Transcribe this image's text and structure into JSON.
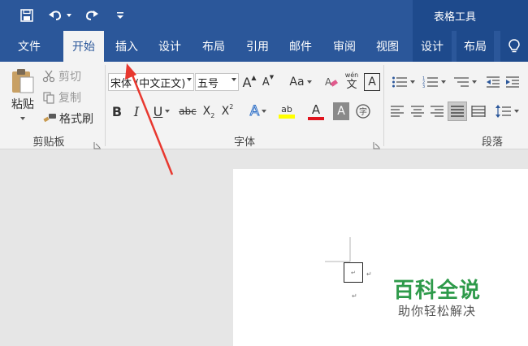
{
  "app": {
    "context_title": "表格工具"
  },
  "tabs": [
    {
      "label": "文件"
    },
    {
      "label": "开始"
    },
    {
      "label": "插入"
    },
    {
      "label": "设计"
    },
    {
      "label": "布局"
    },
    {
      "label": "引用"
    },
    {
      "label": "邮件"
    },
    {
      "label": "审阅"
    },
    {
      "label": "视图"
    },
    {
      "label": "设计"
    },
    {
      "label": "布局"
    }
  ],
  "clipboard": {
    "paste": "粘贴",
    "cut": "剪切",
    "copy": "复制",
    "format_painter": "格式刷",
    "group_label": "剪贴板"
  },
  "font": {
    "font_name": "宋体 (中文正文)",
    "font_size": "五号",
    "grow": "A",
    "shrink": "A",
    "change_case": "Aa",
    "phonetic_top": "wén",
    "phonetic_bottom": "文",
    "char_border": "A",
    "bold": "B",
    "italic": "I",
    "underline": "U",
    "strikethrough": "abc",
    "subscript": "X",
    "superscript": "X",
    "text_effects": "A",
    "highlight": "ab",
    "font_color": "A",
    "char_shading": "A",
    "enclose": "字",
    "group_label": "字体"
  },
  "paragraph": {
    "group_label": "段落"
  },
  "watermark": {
    "title": "百科全说",
    "subtitle": "助你轻松解决"
  },
  "colors": {
    "ribbon_blue": "#2b579a",
    "context_blue": "#1e4a8c",
    "highlight_yellow": "#ffff00",
    "font_red": "#e0141e",
    "arrow_red": "#e8382f",
    "watermark_green": "#2e9a4a"
  }
}
